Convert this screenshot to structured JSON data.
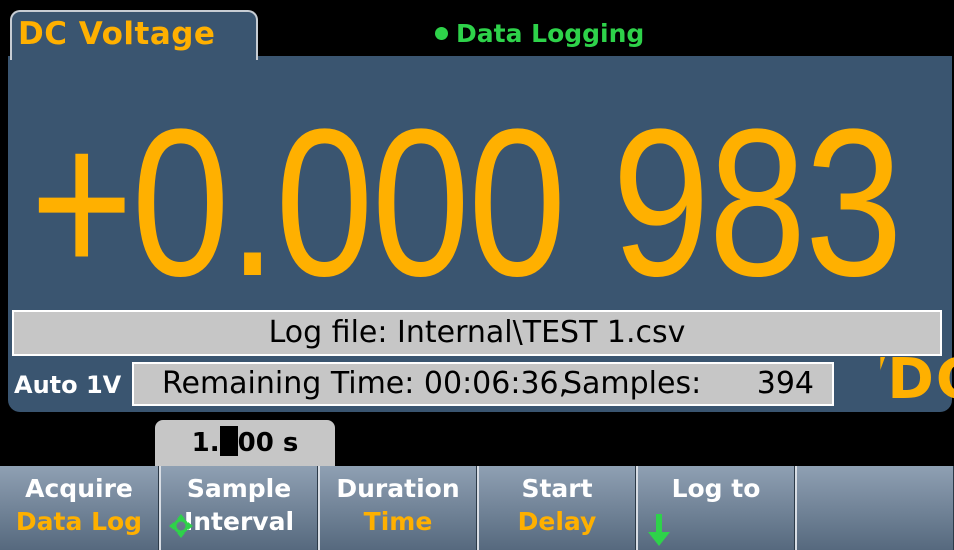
{
  "mode": "DC Voltage",
  "status": {
    "text": "Data Logging",
    "color": "#2ed24a"
  },
  "reading": "+0.000 983",
  "unit": "VDC",
  "log_file": "Log file: Internal\\TEST 1.csv",
  "range": "Auto 1V",
  "remaining": {
    "time_label": "Remaining Time: 00:06:36,",
    "samples_label": "Samples:",
    "samples_value": "394"
  },
  "interval_value": {
    "before": "1.",
    "cursor_digit": "0",
    "after": "00 s"
  },
  "softkeys": [
    {
      "line1": "Acquire",
      "line2": "Data Log"
    },
    {
      "line1": "Sample",
      "line2": "Interval",
      "icon": "knob-icon"
    },
    {
      "line1": "Duration",
      "line2": "Time"
    },
    {
      "line1": "Start",
      "line2": "Delay"
    },
    {
      "line1": "Log to",
      "icon": "down-arrow-icon"
    },
    {
      "line1": ""
    }
  ],
  "colors": {
    "accent": "#ffb000",
    "panel": "#3a5570",
    "status_green": "#2ed24a"
  }
}
